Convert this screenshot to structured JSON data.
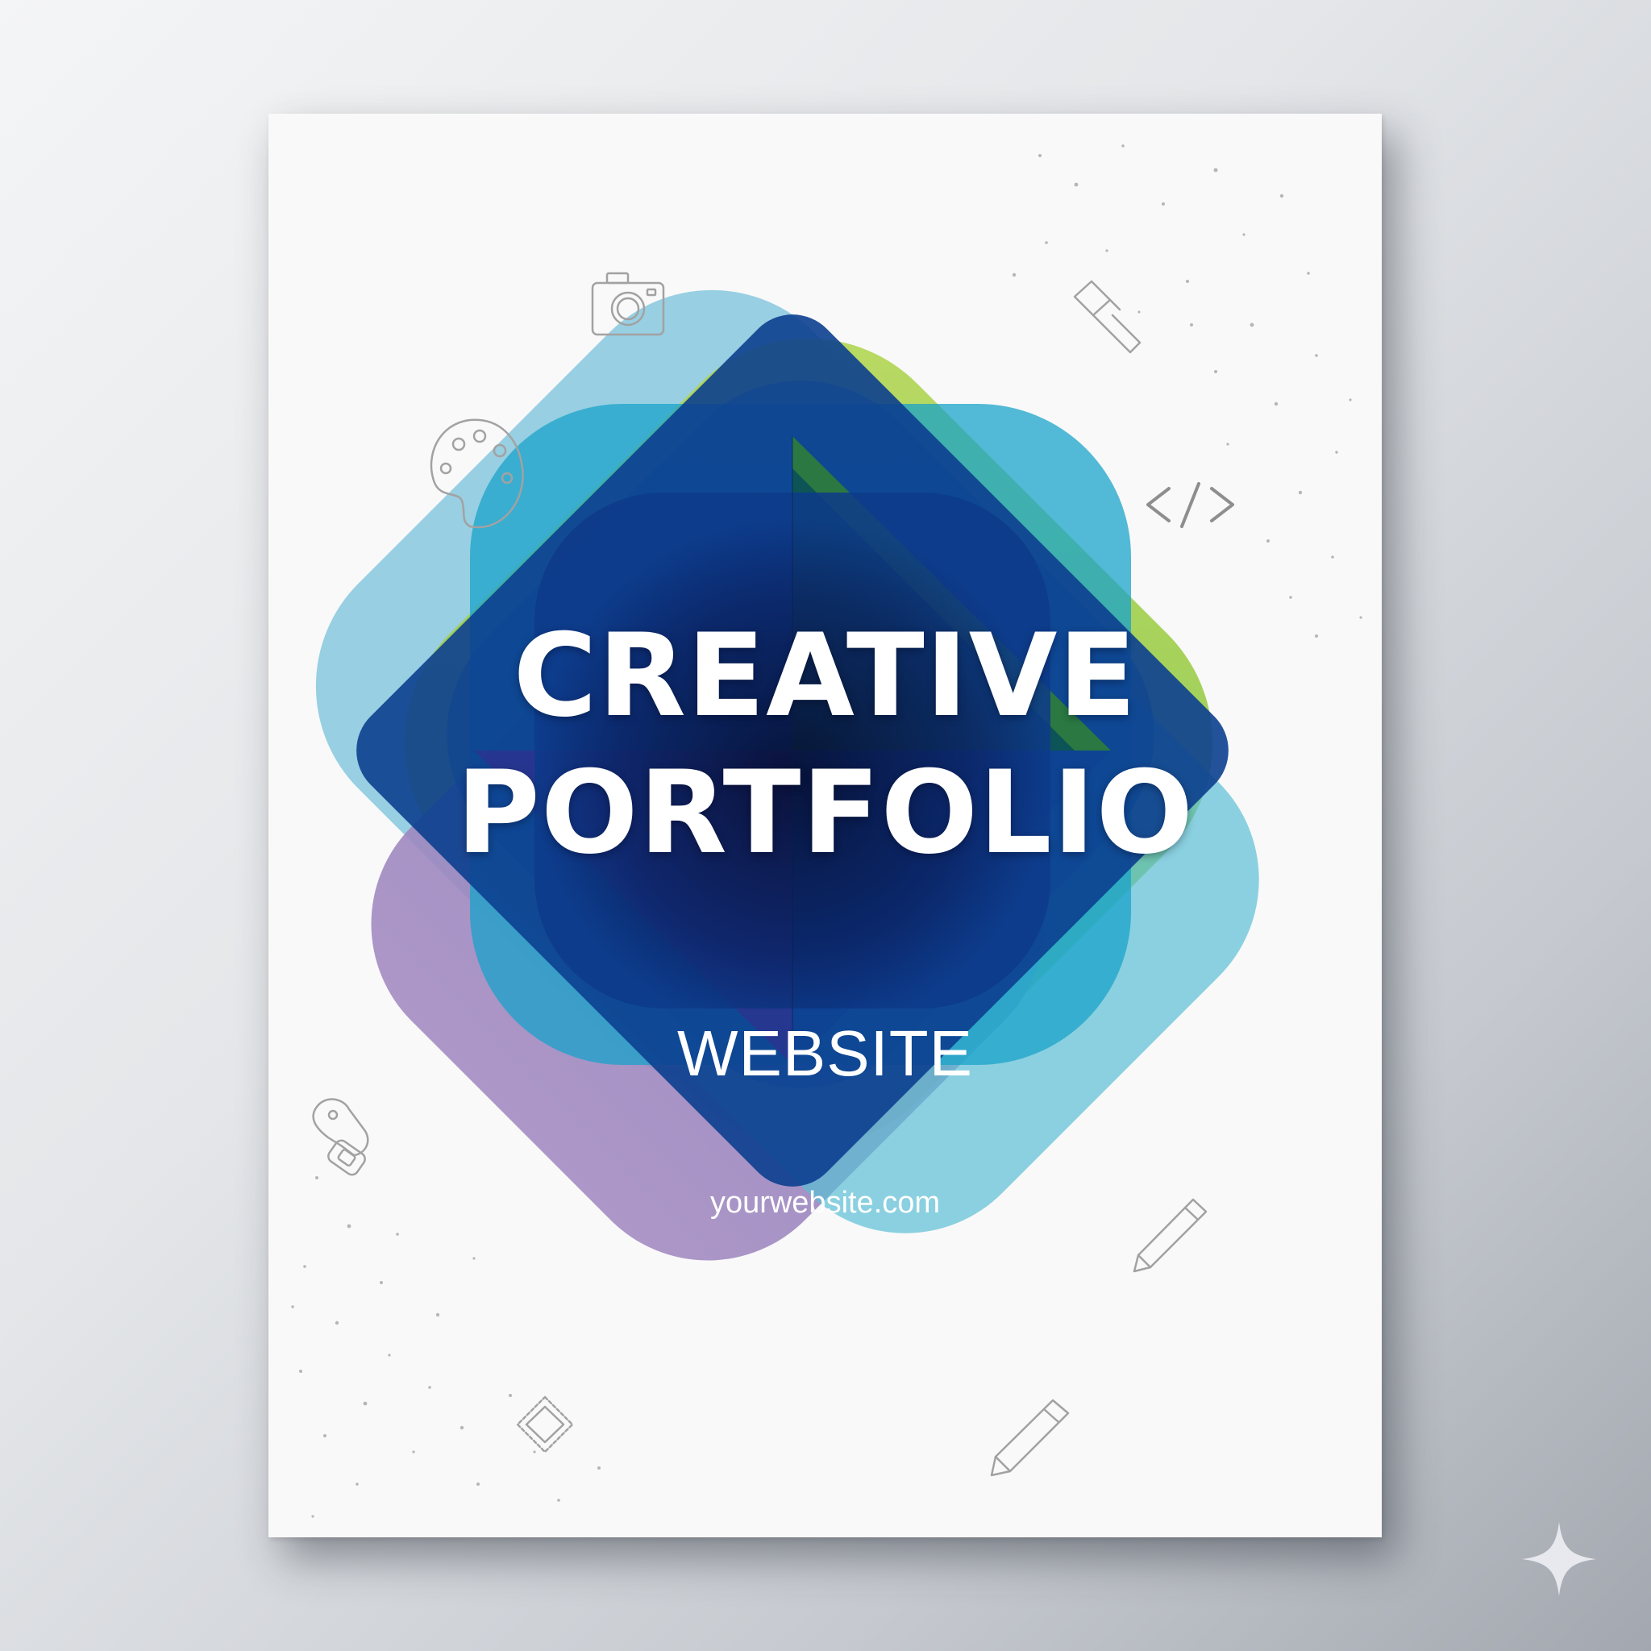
{
  "poster": {
    "title_line_1": "CREATIVE",
    "title_line_2": "PORTFOLIO",
    "subtitle": "WEBSITE",
    "url": "yourwebsite.com"
  },
  "icons": [
    "camera-icon",
    "palette-icon",
    "paint-brush-icon",
    "code-icon",
    "gamepad-icon",
    "pencil-icon",
    "stamp-icon"
  ],
  "colors": {
    "background": "#f9f9f9",
    "accent_green": "#8cc63f",
    "accent_blue": "#1a9bd7",
    "accent_teal": "#5bbfd6",
    "accent_purple": "#7b4fa8",
    "accent_navy": "#0d2a6b",
    "icon_stroke": "#a0a0a0"
  }
}
